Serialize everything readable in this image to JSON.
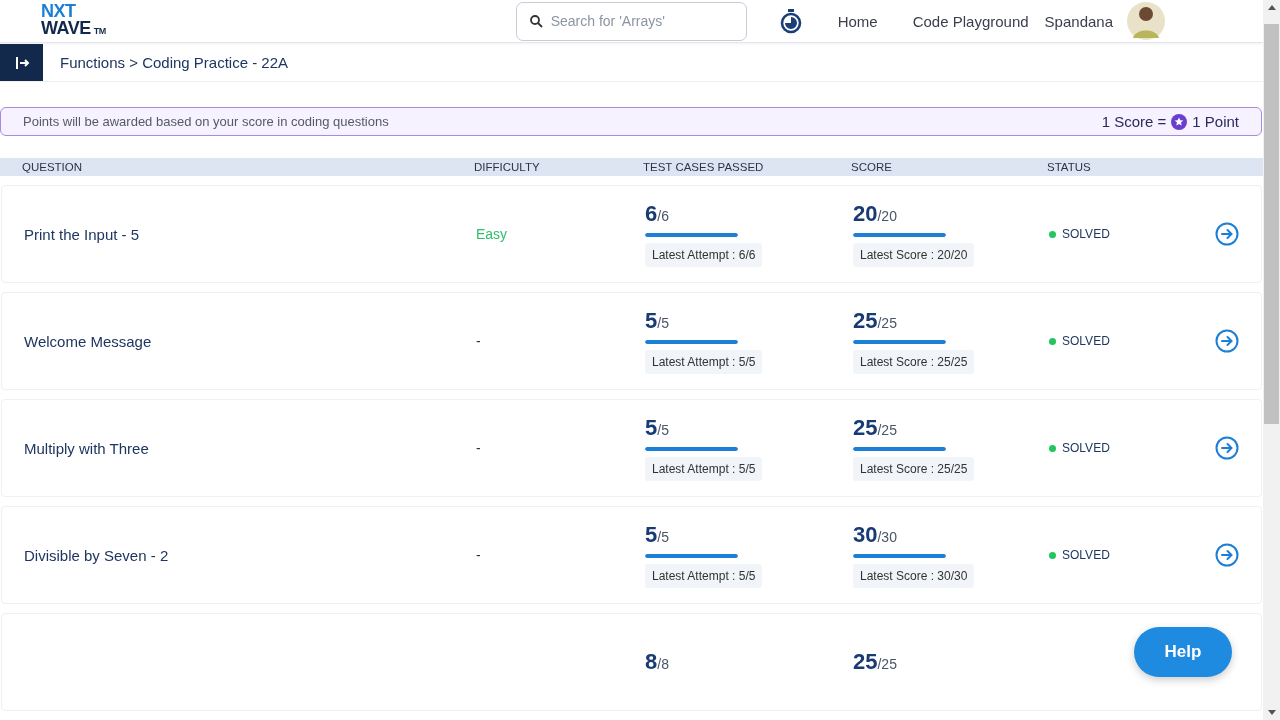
{
  "logo": {
    "line1": "NXT",
    "line2": "WAVE",
    "mark": "TM"
  },
  "search": {
    "placeholder": "Search for 'Arrays'"
  },
  "nav": [
    "Home",
    "Code Playground"
  ],
  "user": {
    "name": "Spandana"
  },
  "breadcrumb": "Functions > Coding Practice - 22A",
  "banner": {
    "text": "Points will be awarded based on your score in coding questions",
    "left": "1 Score =",
    "right": "1 Point"
  },
  "columns": [
    "QUESTION",
    "DIFFICULTY",
    "TEST CASES PASSED",
    "SCORE",
    "STATUS"
  ],
  "rows": [
    {
      "question": "Print the Input - 5",
      "difficulty": "Easy",
      "color": "#2ebd6b",
      "passed": "6",
      "passed_total": "/6",
      "passed_meter": {
        "level": 1
      },
      "attempt": "Latest Attempt : 6/6",
      "score": "20",
      "score_total": "/20",
      "score_meter": {
        "level": 1
      },
      "latest_score": "Latest Score : 20/20",
      "status": "SOLVED"
    },
    {
      "question": "Welcome Message",
      "difficulty": "-",
      "passed": "5",
      "passed_total": "/5",
      "passed_meter": {
        "level": 1
      },
      "attempt": "Latest Attempt : 5/5",
      "score": "25",
      "score_total": "/25",
      "score_meter": {
        "level": 1
      },
      "latest_score": "Latest Score : 25/25",
      "status": "SOLVED"
    },
    {
      "question": "Multiply with Three",
      "difficulty": "-",
      "passed": "5",
      "passed_total": "/5",
      "passed_meter": {
        "level": 1
      },
      "attempt": "Latest Attempt : 5/5",
      "score": "25",
      "score_total": "/25",
      "score_meter": {
        "level": 1
      },
      "latest_score": "Latest Score : 25/25",
      "status": "SOLVED"
    },
    {
      "question": "Divisible by Seven - 2",
      "difficulty": "-",
      "passed": "5",
      "passed_total": "/5",
      "passed_meter": {
        "level": 1
      },
      "attempt": "Latest Attempt : 5/5",
      "score": "30",
      "score_total": "/30",
      "score_meter": {
        "level": 1
      },
      "latest_score": "Latest Score : 30/30",
      "status": "SOLVED"
    },
    {
      "passed": "8",
      "passed_total": "/8",
      "score": "25",
      "score_total": "/25"
    }
  ],
  "help": "Help"
}
